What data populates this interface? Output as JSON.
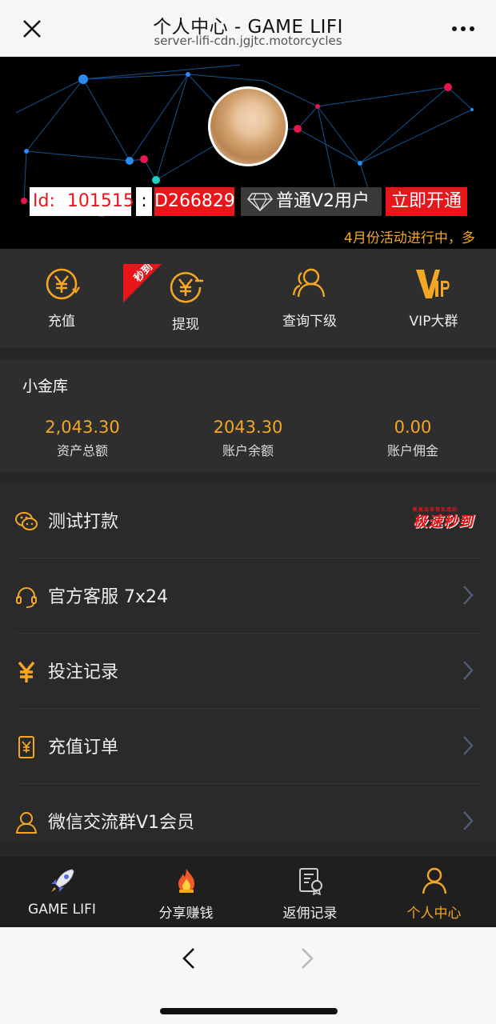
{
  "topbar": {
    "title": "个人中心 - GAME LIFI",
    "subtitle": "server-lifi-cdn.jgjtc.motorcycles",
    "close_icon": "close-icon",
    "more_icon": "more-icon"
  },
  "profile": {
    "id_label": "Id:",
    "id_value": "101515",
    "colon": ":",
    "code": "D266829",
    "level": "普通V2用户",
    "activate": "立即开通"
  },
  "marquee": "4月份活动进行中，多",
  "quick_actions": [
    {
      "label": "充值",
      "icon": "yen-recharge-icon"
    },
    {
      "label": "提现",
      "icon": "yen-withdraw-icon"
    },
    {
      "label": "查询下级",
      "icon": "users-icon"
    },
    {
      "label": "VIP大群",
      "icon": "vip-icon"
    }
  ],
  "corner_tag": "秒到",
  "vault": {
    "title": "小金库",
    "items": [
      {
        "value": "2,043.30",
        "label": "资产总额"
      },
      {
        "value": "2043.30",
        "label": "账户余额"
      },
      {
        "value": "0.00",
        "label": "账户佣金"
      }
    ]
  },
  "menu": [
    {
      "label": "测试打款",
      "icon": "wechat-icon",
      "badge": "极速秒到",
      "badge_small": "新推出非常实用的"
    },
    {
      "label": "官方客服 7x24",
      "icon": "headset-icon"
    },
    {
      "label": "投注记录",
      "icon": "yen-icon"
    },
    {
      "label": "充值订单",
      "icon": "order-icon"
    },
    {
      "label": "微信交流群V1会员",
      "icon": "user-outline-icon"
    }
  ],
  "tabbar": [
    {
      "label": "GAME LIFI",
      "icon": "rocket-icon"
    },
    {
      "label": "分享赚钱",
      "icon": "fire-icon"
    },
    {
      "label": "返佣记录",
      "icon": "certificate-icon"
    },
    {
      "label": "个人中心",
      "icon": "person-icon",
      "active": true
    }
  ],
  "colors": {
    "accent": "#f5a623",
    "red": "#e8161b",
    "background": "#262626"
  }
}
